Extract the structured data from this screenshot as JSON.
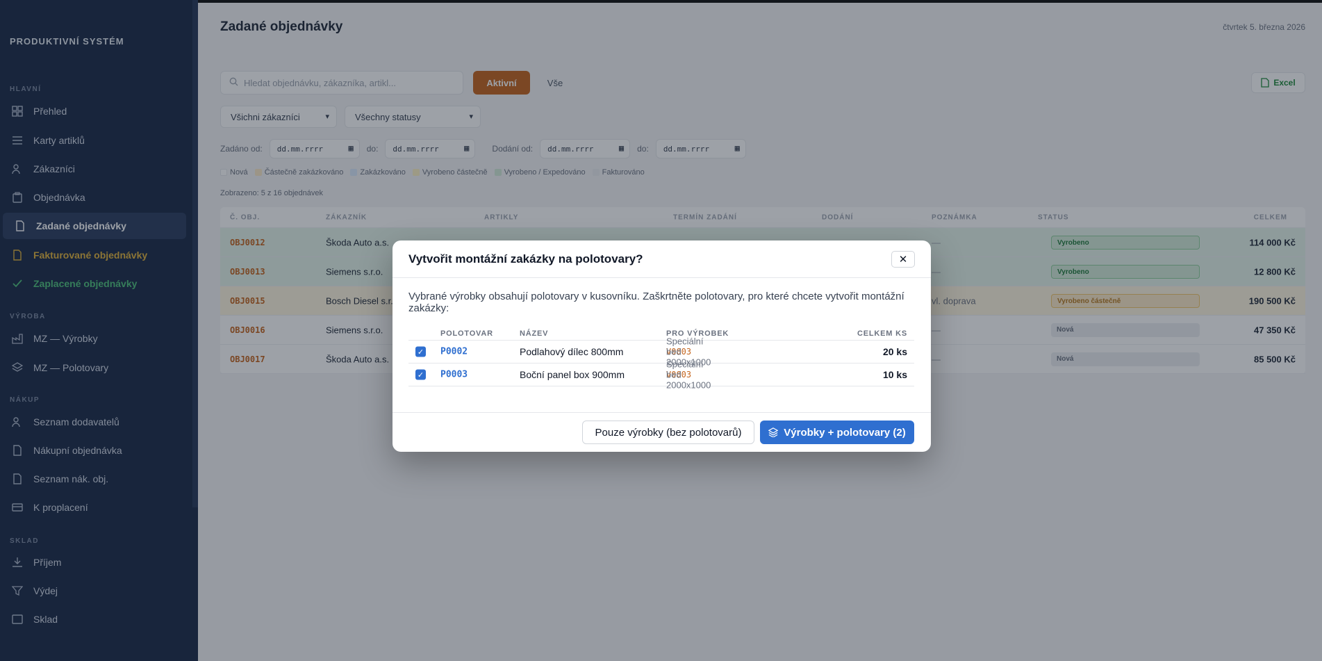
{
  "sidebar": {
    "brand": "PRODUKTIVNÍ SYSTÉM",
    "sections": [
      "HLAVNÍ",
      "VÝROBA",
      "NÁKUP",
      "SKLAD"
    ],
    "items": [
      {
        "label": "Přehled",
        "icon": "grid-icon"
      },
      {
        "label": "Karty artiklů",
        "icon": "list-icon"
      },
      {
        "label": "Zákazníci",
        "icon": "users-icon"
      },
      {
        "label": "Objednávka",
        "icon": "clipboard-icon"
      },
      {
        "label": "Zadané objednávky",
        "icon": "document-icon"
      },
      {
        "label": "Fakturované objednávky",
        "icon": "invoice-icon"
      },
      {
        "label": "Zaplacené objednávky",
        "icon": "check-icon"
      },
      {
        "label": "MZ — Výrobky",
        "icon": "factory-icon"
      },
      {
        "label": "MZ — Polotovary",
        "icon": "layers-icon"
      },
      {
        "label": "Seznam dodavatelů",
        "icon": "users-icon"
      },
      {
        "label": "Nákupní objednávka",
        "icon": "document-icon"
      },
      {
        "label": "Seznam nák. obj.",
        "icon": "document-icon"
      },
      {
        "label": "K proplacení",
        "icon": "card-icon"
      },
      {
        "label": "Příjem",
        "icon": "download-icon"
      },
      {
        "label": "Výdej",
        "icon": "filter-icon"
      },
      {
        "label": "Sklad",
        "icon": "box-icon"
      }
    ]
  },
  "header": {
    "title": "Zadané objednávky",
    "date": "čtvrtek 5. března 2026"
  },
  "toolbar": {
    "search_placeholder": "Hledat objednávku, zákazníka, artikl...",
    "active_label": "Aktivní",
    "all_label": "Vše",
    "excel_label": "Excel"
  },
  "filters": {
    "customer": "Všichni zákazníci",
    "status": "Všechny statusy",
    "ordered_from": "Zadáno od:",
    "delivered_from": "Dodání od:",
    "to": "do:",
    "date_placeholder": "dd.mm.rrrr"
  },
  "legend": [
    {
      "label": "Nová",
      "color": "#ffffff"
    },
    {
      "label": "Částečně zakázkováno",
      "color": "#fdebc8"
    },
    {
      "label": "Zakázkováno",
      "color": "#dbeafe"
    },
    {
      "label": "Vyrobeno částečně",
      "color": "#fff3c4"
    },
    {
      "label": "Vyrobeno / Expedováno",
      "color": "#d4edda"
    },
    {
      "label": "Fakturováno",
      "color": "#eceef1"
    }
  ],
  "shown_text": "Zobrazeno: 5 z 16 objednávek",
  "table": {
    "headers": [
      "Č. OBJ.",
      "ZÁKAZNÍK",
      "ARTIKLY",
      "TERMÍN ZADÁNÍ",
      "DODÁNÍ",
      "POZNÁMKA",
      "STATUS",
      "CELKEM"
    ],
    "rows": [
      {
        "num": "OBJ0012",
        "customer": "Škoda Auto a.s.",
        "note": "—",
        "status": "Vyrobeno",
        "total": "114 000 Kč"
      },
      {
        "num": "OBJ0013",
        "customer": "Siemens s.r.o.",
        "note": "—",
        "status": "Vyrobeno",
        "total": "12 800 Kč"
      },
      {
        "num": "OBJ0015",
        "customer": "Bosch Diesel s.r.o.",
        "note": "vl. doprava",
        "status": "Vyrobeno částečně",
        "total": "190 500 Kč"
      },
      {
        "num": "OBJ0016",
        "customer": "Siemens s.r.o.",
        "note": "—",
        "status": "Nová",
        "total": "47 350 Kč"
      },
      {
        "num": "OBJ0017",
        "customer": "Škoda Auto a.s.",
        "note": "—",
        "status": "Nová",
        "total": "85 500 Kč"
      }
    ]
  },
  "modal": {
    "title": "Vytvořit montážní zakázky na polotovary?",
    "close_label": "✕",
    "description": "Vybrané výrobky obsahují polotovary v kusovníku. Zaškrtněte polotovary, pro které chcete vytvořit montážní zakázky:",
    "headers": {
      "code": "POLOTOVAR",
      "name": "NÁZEV",
      "for": "PRO VÝROBEK",
      "qty": "CELKEM KS"
    },
    "rows": [
      {
        "checked": true,
        "code": "P0002",
        "name": "Podlahový dílec 800mm",
        "for_code": "V0003",
        "for_name": "Speciální bed 2000x1000",
        "qty": "20 ks"
      },
      {
        "checked": true,
        "code": "P0003",
        "name": "Boční panel box 900mm",
        "for_code": "V0003",
        "for_name": "Speciální bed 2000x1000",
        "qty": "10 ks"
      }
    ],
    "secondary_label": "Pouze výrobky (bez polotovarů)",
    "primary_label": "Výrobky + polotovary (2)",
    "primary_color": "#2f6fd0"
  }
}
